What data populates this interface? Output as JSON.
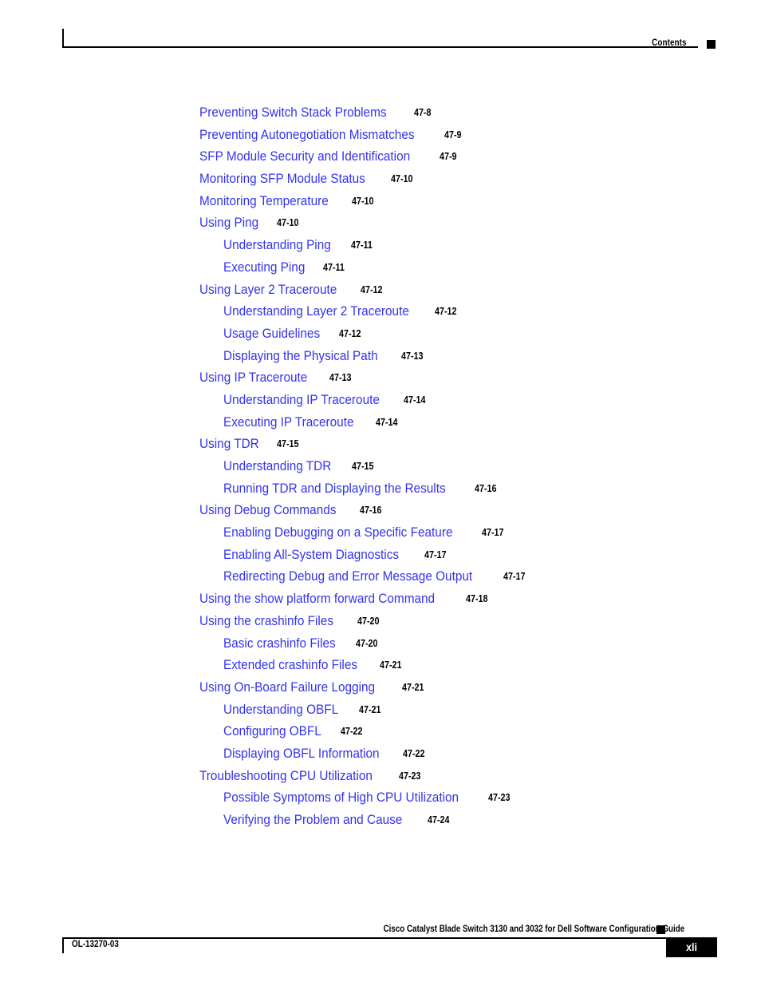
{
  "header": {
    "label": "Contents",
    "marker_icon": "black-square-icon"
  },
  "toc": {
    "entries": [
      {
        "title": "Preventing Switch Stack Problems",
        "page": "47-8",
        "level": 1
      },
      {
        "title": "Preventing Autonegotiation Mismatches",
        "page": "47-9",
        "level": 1
      },
      {
        "title": "SFP Module Security and Identification",
        "page": "47-9",
        "level": 1
      },
      {
        "title": "Monitoring SFP Module Status",
        "page": "47-10",
        "level": 1
      },
      {
        "title": "Monitoring Temperature",
        "page": "47-10",
        "level": 1
      },
      {
        "title": "Using Ping",
        "page": "47-10",
        "level": 1
      },
      {
        "title": "Understanding Ping",
        "page": "47-11",
        "level": 2
      },
      {
        "title": "Executing Ping",
        "page": "47-11",
        "level": 2
      },
      {
        "title": "Using Layer 2 Traceroute",
        "page": "47-12",
        "level": 1
      },
      {
        "title": "Understanding Layer 2 Traceroute",
        "page": "47-12",
        "level": 2
      },
      {
        "title": "Usage Guidelines",
        "page": "47-12",
        "level": 2
      },
      {
        "title": "Displaying the Physical Path",
        "page": "47-13",
        "level": 2
      },
      {
        "title": "Using IP Traceroute",
        "page": "47-13",
        "level": 1
      },
      {
        "title": "Understanding IP Traceroute",
        "page": "47-14",
        "level": 2
      },
      {
        "title": "Executing IP Traceroute",
        "page": "47-14",
        "level": 2
      },
      {
        "title": "Using TDR",
        "page": "47-15",
        "level": 1
      },
      {
        "title": "Understanding TDR",
        "page": "47-15",
        "level": 2
      },
      {
        "title": "Running TDR and Displaying the Results",
        "page": "47-16",
        "level": 2
      },
      {
        "title": "Using Debug Commands",
        "page": "47-16",
        "level": 1
      },
      {
        "title": "Enabling Debugging on a Specific Feature",
        "page": "47-17",
        "level": 2
      },
      {
        "title": "Enabling All-System Diagnostics",
        "page": "47-17",
        "level": 2
      },
      {
        "title": "Redirecting Debug and Error Message Output",
        "page": "47-17",
        "level": 2
      },
      {
        "title": "Using the show platform forward Command",
        "page": "47-18",
        "level": 1
      },
      {
        "title": "Using the crashinfo Files",
        "page": "47-20",
        "level": 1
      },
      {
        "title": "Basic crashinfo Files",
        "page": "47-20",
        "level": 2
      },
      {
        "title": "Extended crashinfo Files",
        "page": "47-21",
        "level": 2
      },
      {
        "title": "Using On-Board Failure Logging",
        "page": "47-21",
        "level": 1
      },
      {
        "title": "Understanding OBFL",
        "page": "47-21",
        "level": 2
      },
      {
        "title": "Configuring OBFL",
        "page": "47-22",
        "level": 2
      },
      {
        "title": "Displaying OBFL Information",
        "page": "47-22",
        "level": 2
      },
      {
        "title": "Troubleshooting CPU Utilization",
        "page": "47-23",
        "level": 1
      },
      {
        "title": "Possible Symptoms of High CPU Utilization",
        "page": "47-23",
        "level": 2
      },
      {
        "title": "Verifying the Problem and Cause",
        "page": "47-24",
        "level": 2
      }
    ]
  },
  "footer": {
    "document_title": "Cisco Catalyst Blade Switch 3130 and 3032 for Dell Software Configuration Guide",
    "document_number": "OL-13270-03",
    "page_number": "xli",
    "marker_icon": "black-square-icon"
  },
  "colors": {
    "link": "#3333ee",
    "text": "#000000",
    "background": "#ffffff"
  }
}
